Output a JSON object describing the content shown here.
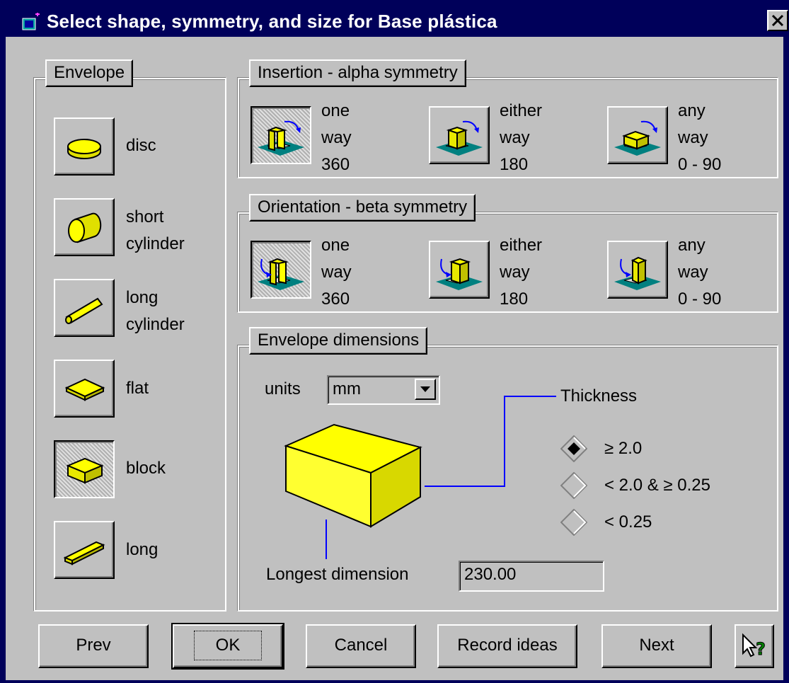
{
  "window": {
    "title": "Select shape, symmetry, and size for Base plástica"
  },
  "envelope": {
    "label": "Envelope",
    "items": [
      {
        "id": "disc",
        "lines": [
          "disc"
        ]
      },
      {
        "id": "short-cylinder",
        "lines": [
          "short",
          "cylinder"
        ]
      },
      {
        "id": "long-cylinder",
        "lines": [
          "long",
          "cylinder"
        ]
      },
      {
        "id": "flat",
        "lines": [
          "flat"
        ]
      },
      {
        "id": "block",
        "lines": [
          "block"
        ],
        "selected": true
      },
      {
        "id": "long",
        "lines": [
          "long"
        ]
      }
    ]
  },
  "alpha": {
    "label": "Insertion - alpha symmetry",
    "options": [
      {
        "lines": [
          "one",
          "way",
          "360"
        ],
        "selected": true
      },
      {
        "lines": [
          "either",
          "way",
          "180"
        ]
      },
      {
        "lines": [
          "any",
          "way",
          "0 - 90"
        ]
      }
    ]
  },
  "beta": {
    "label": "Orientation - beta symmetry",
    "options": [
      {
        "lines": [
          "one",
          "way",
          "360"
        ],
        "selected": true
      },
      {
        "lines": [
          "either",
          "way",
          "180"
        ]
      },
      {
        "lines": [
          "any",
          "way",
          "0 - 90"
        ]
      }
    ]
  },
  "dims": {
    "label": "Envelope dimensions",
    "units_label": "units",
    "units_value": "mm",
    "thickness_label": "Thickness",
    "thickness_options": [
      "≥ 2.0",
      "< 2.0 & ≥ 0.25",
      "< 0.25"
    ],
    "thickness_selected": 0,
    "longest_label": "Longest dimension",
    "longest_value": "230.00"
  },
  "buttons": {
    "prev": "Prev",
    "ok": "OK",
    "cancel": "Cancel",
    "record": "Record ideas",
    "next": "Next"
  },
  "colors": {
    "title_bg": "#00005a",
    "face": "#c0c0c0",
    "shape": "#ffff00",
    "accent": "#0000ff",
    "teal": "#008080"
  }
}
